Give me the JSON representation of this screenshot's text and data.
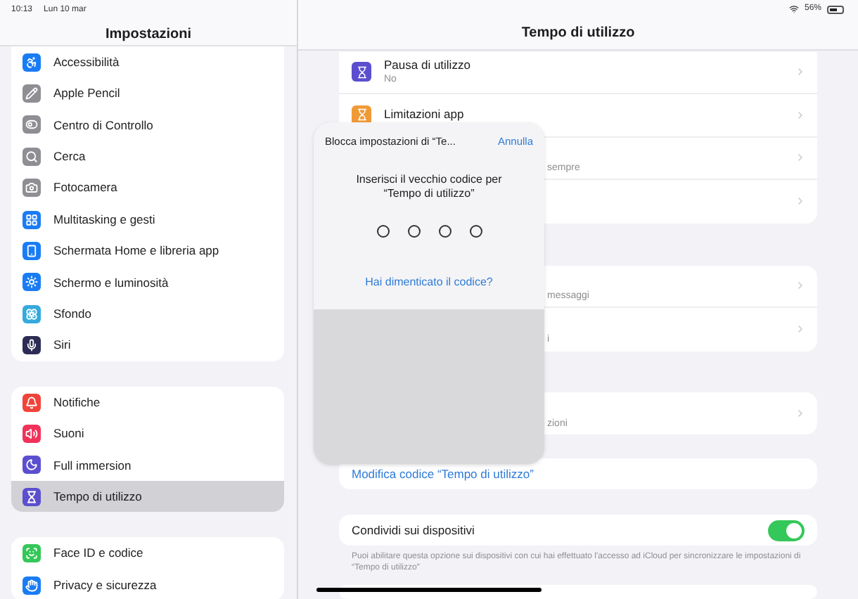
{
  "status_bar": {
    "time": "10:13",
    "date": "Lun 10 mar",
    "battery": "56%"
  },
  "sidebar": {
    "title": "Impostazioni",
    "groups": [
      {
        "items": [
          {
            "label": "Accessibilità",
            "color": "#1a7cf5",
            "selected": false
          },
          {
            "label": "Apple Pencil",
            "color": "#8e8e93",
            "selected": false
          },
          {
            "label": "Centro di Controllo",
            "color": "#8e8e93",
            "selected": false
          },
          {
            "label": "Cerca",
            "color": "#8e8e93",
            "selected": false
          },
          {
            "label": "Fotocamera",
            "color": "#8e8e93",
            "selected": false
          },
          {
            "label": "Multitasking e gesti",
            "color": "#1a7cf5",
            "selected": false
          },
          {
            "label": "Schermata Home e libreria app",
            "color": "#1a7cf5",
            "selected": false
          },
          {
            "label": "Schermo e luminosità",
            "color": "#1a7cf5",
            "selected": false
          },
          {
            "label": "Sfondo",
            "color": "#34aadc",
            "selected": false
          },
          {
            "label": "Siri",
            "color": "#2c2c54",
            "selected": false
          }
        ]
      },
      {
        "items": [
          {
            "label": "Notifiche",
            "color": "#f0443a",
            "selected": false
          },
          {
            "label": "Suoni",
            "color": "#f0325a",
            "selected": false
          },
          {
            "label": "Full immersion",
            "color": "#5b4fcf",
            "selected": false
          },
          {
            "label": "Tempo di utilizzo",
            "color": "#5b4fcf",
            "selected": true
          }
        ]
      },
      {
        "items": [
          {
            "label": "Face ID e codice",
            "color": "#34c759",
            "selected": false
          },
          {
            "label": "Privacy e sicurezza",
            "color": "#1a7cf5",
            "selected": false
          }
        ]
      }
    ]
  },
  "detail": {
    "title": "Tempo di utilizzo",
    "cards": [
      {
        "rows": [
          {
            "kind": "item",
            "title": "Pausa di utilizzo",
            "subtitle": "No",
            "color": "#5b4fcf"
          },
          {
            "kind": "item",
            "title": "Limitazioni app",
            "color": "#f09a37"
          },
          {
            "kind": "obscured",
            "fragment": "sempre"
          },
          {
            "kind": "obscured"
          }
        ]
      },
      {
        "rows": [
          {
            "kind": "obscured",
            "fragment": "messaggi"
          },
          {
            "kind": "obscured",
            "fragment": "i"
          }
        ]
      },
      {
        "rows": [
          {
            "kind": "obscured",
            "fragment": "zioni"
          }
        ]
      }
    ],
    "change_code": "Modifica codice “Tempo di utilizzo”",
    "share": {
      "label": "Condividi sui dispositivi",
      "on": true
    },
    "footnote": "Puoi abilitare questa opzione sui dispositivi con cui hai effettuato l'accesso ad iCloud per sincronizzare le impostazioni di “Tempo di utilizzo”"
  },
  "popover": {
    "title": "Blocca impostazioni di “Te...",
    "cancel": "Annulla",
    "message": "Inserisci il vecchio codice per “Tempo di utilizzo”",
    "digits": [
      {
        "filled": false
      },
      {
        "filled": false
      },
      {
        "filled": false
      },
      {
        "filled": false
      }
    ],
    "forgot": "Hai dimenticato il codice?"
  }
}
